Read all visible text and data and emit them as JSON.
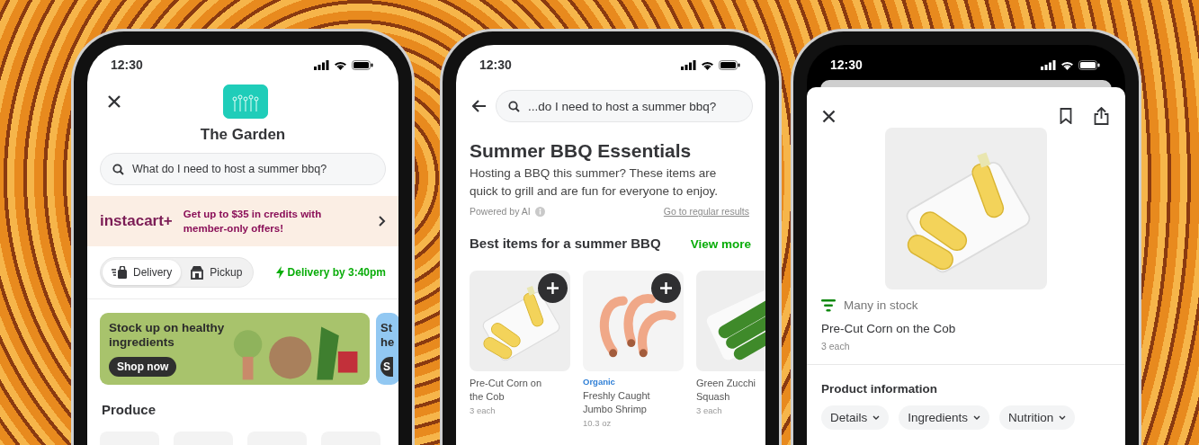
{
  "store_screen": {
    "status_time": "12:30",
    "store_name": "The Garden",
    "search": {
      "placeholder": "What do I need to host a summer bbq?"
    },
    "promo": {
      "brand": "instacart+",
      "text": "Get up to $35 in credits with member-only offers!"
    },
    "mode_toggle": [
      {
        "label": "Delivery",
        "kind": "delivery",
        "selected": true
      },
      {
        "label": "Pickup",
        "kind": "pickup",
        "selected": false
      }
    ],
    "delivery_eta": "Delivery by 3:40pm",
    "banners": [
      {
        "title": "Stock up on healthy ingredients",
        "button": "Shop now",
        "color": "#a8c36c"
      },
      {
        "title": "St he",
        "button": "S",
        "color": "#92c8f2"
      }
    ],
    "section_title": "Produce"
  },
  "results_screen": {
    "status_time": "12:30",
    "search": {
      "value": "...do I need to host a summer bbq?"
    },
    "title": "Summer BBQ Essentials",
    "description": "Hosting a BBQ this summer? These items are quick to grill and are fun for everyone to enjoy.",
    "powered_by": "Powered by AI",
    "regular_results_link": "Go to regular results",
    "section_title": "Best items for a summer BBQ",
    "view_more": "View more",
    "products": [
      {
        "kind": "corn",
        "name": "Pre-Cut Corn on the Cob",
        "size": "3 each",
        "add_button": true
      },
      {
        "kind": "shrimp",
        "tag": "Organic",
        "name": "Freshly Caught Jumbo Shrimp",
        "size": "10.3 oz",
        "add_button": true
      },
      {
        "kind": "zucchini",
        "name": "Green Zucchi Squash",
        "size": "3 each",
        "add_button": false
      }
    ]
  },
  "product_screen": {
    "status_time": "12:30",
    "kind": "corn",
    "stock": "Many in stock",
    "name": "Pre-Cut Corn on the Cob",
    "size": "3 each",
    "section_title": "Product information",
    "chips": [
      "Details",
      "Ingredients",
      "Nutrition"
    ]
  }
}
